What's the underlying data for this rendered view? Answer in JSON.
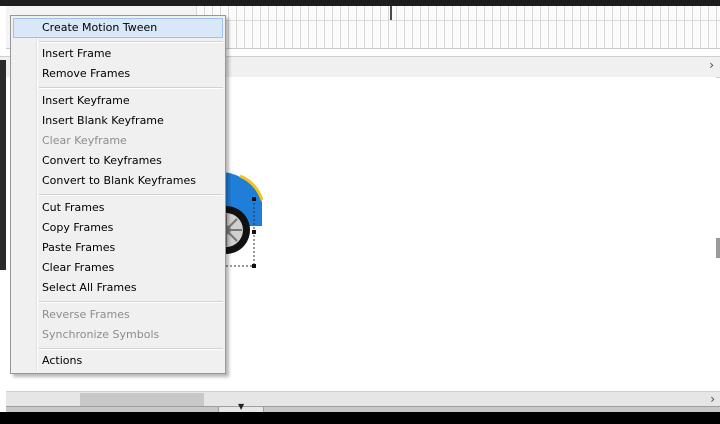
{
  "menu": {
    "items": [
      {
        "label": "Create Motion Tween",
        "enabled": true,
        "highlighted": true
      },
      {
        "label": "Insert Frame",
        "enabled": true
      },
      {
        "label": "Remove Frames",
        "enabled": true
      },
      {
        "label": "Insert Keyframe",
        "enabled": true
      },
      {
        "label": "Insert Blank Keyframe",
        "enabled": true
      },
      {
        "label": "Clear Keyframe",
        "enabled": false
      },
      {
        "label": "Convert to Keyframes",
        "enabled": true
      },
      {
        "label": "Convert to Blank Keyframes",
        "enabled": true
      },
      {
        "label": "Cut Frames",
        "enabled": true
      },
      {
        "label": "Copy Frames",
        "enabled": true
      },
      {
        "label": "Paste Frames",
        "enabled": true
      },
      {
        "label": "Clear Frames",
        "enabled": true
      },
      {
        "label": "Select All Frames",
        "enabled": true
      },
      {
        "label": "Reverse Frames",
        "enabled": false
      },
      {
        "label": "Synchronize Symbols",
        "enabled": false
      },
      {
        "label": "Actions",
        "enabled": true
      }
    ]
  },
  "editbar": {
    "arrow_icon": "chevron-right-icon"
  },
  "hscroll": {
    "arrow_icon": "chevron-right-icon"
  },
  "bottom_panel": {
    "collapse_icon": "triangle-down-icon"
  },
  "colors": {
    "menu_bg": "#f0f0f0",
    "menu_highlight": "#d9e8f9",
    "disabled_text": "#8c8c8c",
    "car_body": "#1f7fd8",
    "car_stripe": "#f2c31a"
  }
}
